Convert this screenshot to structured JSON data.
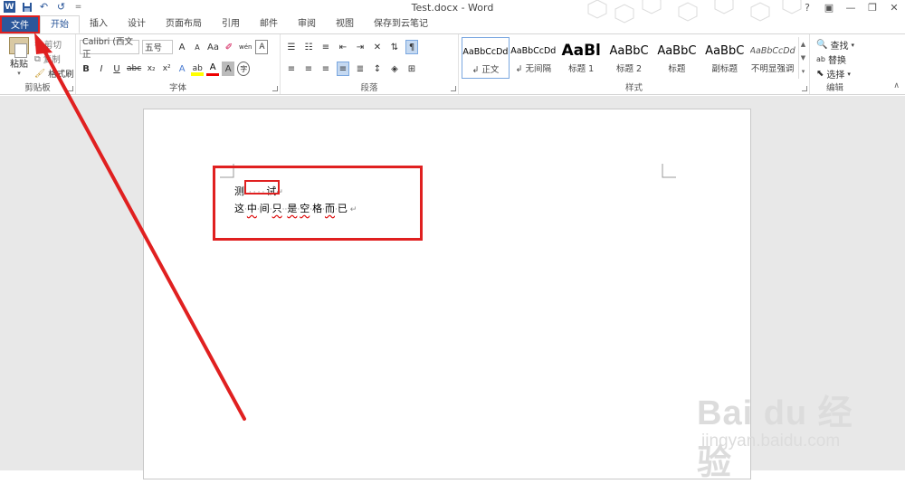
{
  "window": {
    "title": "Test.docx - Word",
    "controls": {
      "help": "?",
      "minimize": "—",
      "restore": "❐",
      "close": "✕"
    }
  },
  "qat": {
    "word_logo": "W",
    "save": "💾",
    "undo": "↶",
    "redo": "↺",
    "more": "="
  },
  "tabs": [
    {
      "label": "文件"
    },
    {
      "label": "开始"
    },
    {
      "label": "插入"
    },
    {
      "label": "设计"
    },
    {
      "label": "页面布局"
    },
    {
      "label": "引用"
    },
    {
      "label": "邮件"
    },
    {
      "label": "审阅"
    },
    {
      "label": "视图"
    },
    {
      "label": "保存到云笔记"
    }
  ],
  "ribbon": {
    "clipboard": {
      "label": "剪贴板",
      "paste": "粘贴",
      "cut": "剪切",
      "copy": "复制",
      "format_painter": "格式刷"
    },
    "font": {
      "label": "字体",
      "font_name": "Calibri (西文正",
      "font_size": "五号",
      "grow": "A",
      "shrink": "A",
      "case": "Aa",
      "pinyin": "wén",
      "bold": "B",
      "italic": "I",
      "underline": "U",
      "strike": "abc",
      "sub": "x₂",
      "sup": "x²",
      "effects": "A",
      "highlight": "ab",
      "color": "A",
      "shade": "A",
      "enclose": "字"
    },
    "paragraph": {
      "label": "段落"
    },
    "styles": {
      "label": "样式",
      "items": [
        {
          "preview": "AaBbCcDd",
          "name": "↲ 正文"
        },
        {
          "preview": "AaBbCcDd",
          "name": "↲ 无间隔"
        },
        {
          "preview": "AaBl",
          "name": "标题 1"
        },
        {
          "preview": "AaBbC",
          "name": "标题 2"
        },
        {
          "preview": "AaBbC",
          "name": "标题"
        },
        {
          "preview": "AaBbC",
          "name": "副标题"
        },
        {
          "preview": "AaBbCcDd",
          "name": "不明显强调"
        }
      ]
    },
    "editing": {
      "label": "编辑",
      "find": "查找",
      "replace": "替换",
      "select": "选择"
    }
  },
  "document": {
    "line1_a": "测",
    "line1_dots": "·····",
    "line1_b": "试",
    "line1_mark": "↵",
    "line2_chars": [
      "这",
      "中",
      "间",
      "只",
      "是",
      "空",
      "格",
      "而",
      "已"
    ],
    "line2_mark": "↵"
  },
  "watermark": {
    "brand": "Bai du 经验",
    "url": "jingyan.baidu.com"
  },
  "colors": {
    "accent": "#2b579a",
    "annotation": "#e02020"
  }
}
